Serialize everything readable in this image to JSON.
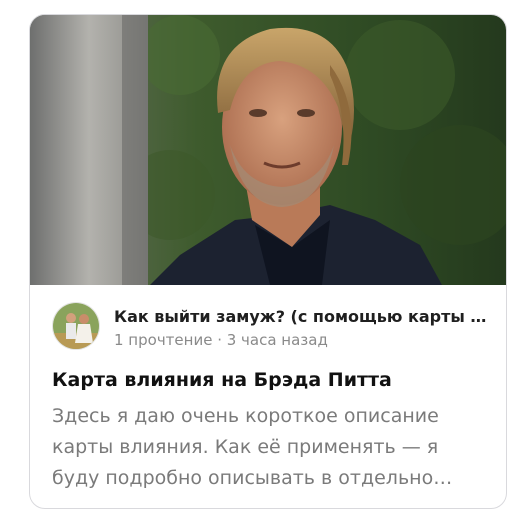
{
  "card": {
    "channel": {
      "name": "Как выйти замуж? (с помощью карты …",
      "avatar_icon": "couple-avatar-icon"
    },
    "stats": "1 прочтение · 3 часа назад",
    "title": "Карта влияния на Брэда Питта",
    "snippet": "Здесь я даю очень короткое описание карты влияния. Как её применять — я буду подробно описывать в отдельно…",
    "hero_image": "portrait-photo"
  },
  "colors": {
    "border": "#d9d9dd",
    "title": "#111111",
    "meta": "#8a8a8a",
    "snippet": "#7a7a7a"
  }
}
